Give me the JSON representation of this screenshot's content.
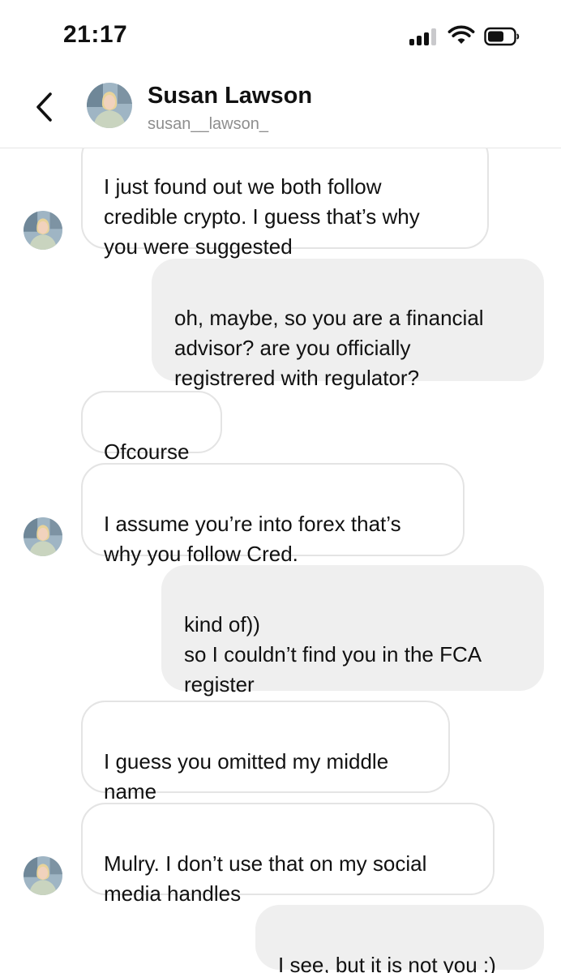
{
  "status_bar": {
    "time": "21:17",
    "icons": [
      "cellular-signal-icon",
      "wifi-icon",
      "battery-icon"
    ]
  },
  "header": {
    "back_icon": "chevron-left-icon",
    "contact_name": "Susan Lawson",
    "contact_handle": "susan__lawson_"
  },
  "messages": [
    {
      "direction": "incoming",
      "text": "I just found out we both follow\ncredible crypto. I guess that’s why\nyou were suggested"
    },
    {
      "direction": "outgoing",
      "text": "oh, maybe, so you are a financial\nadvisor? are you officially\nregistrered with regulator?"
    },
    {
      "direction": "incoming",
      "text": "Ofcourse"
    },
    {
      "direction": "incoming",
      "text": "I assume you’re into forex that’s\nwhy you follow Cred."
    },
    {
      "direction": "outgoing",
      "text": "kind of))\nso I couldn’t find you in the FCA\nregister"
    },
    {
      "direction": "incoming",
      "text": "I guess you omitted my middle\nname"
    },
    {
      "direction": "incoming",
      "text": "Mulry. I don’t use that on my social\nmedia handles"
    },
    {
      "direction": "outgoing",
      "text": "I see, but it is not you :)"
    }
  ],
  "colors": {
    "incoming_bubble": "#ffffff",
    "incoming_border": "#e4e4e4",
    "outgoing_bubble": "#efefef",
    "text": "#111111",
    "secondary_text": "#8e8e8e"
  }
}
